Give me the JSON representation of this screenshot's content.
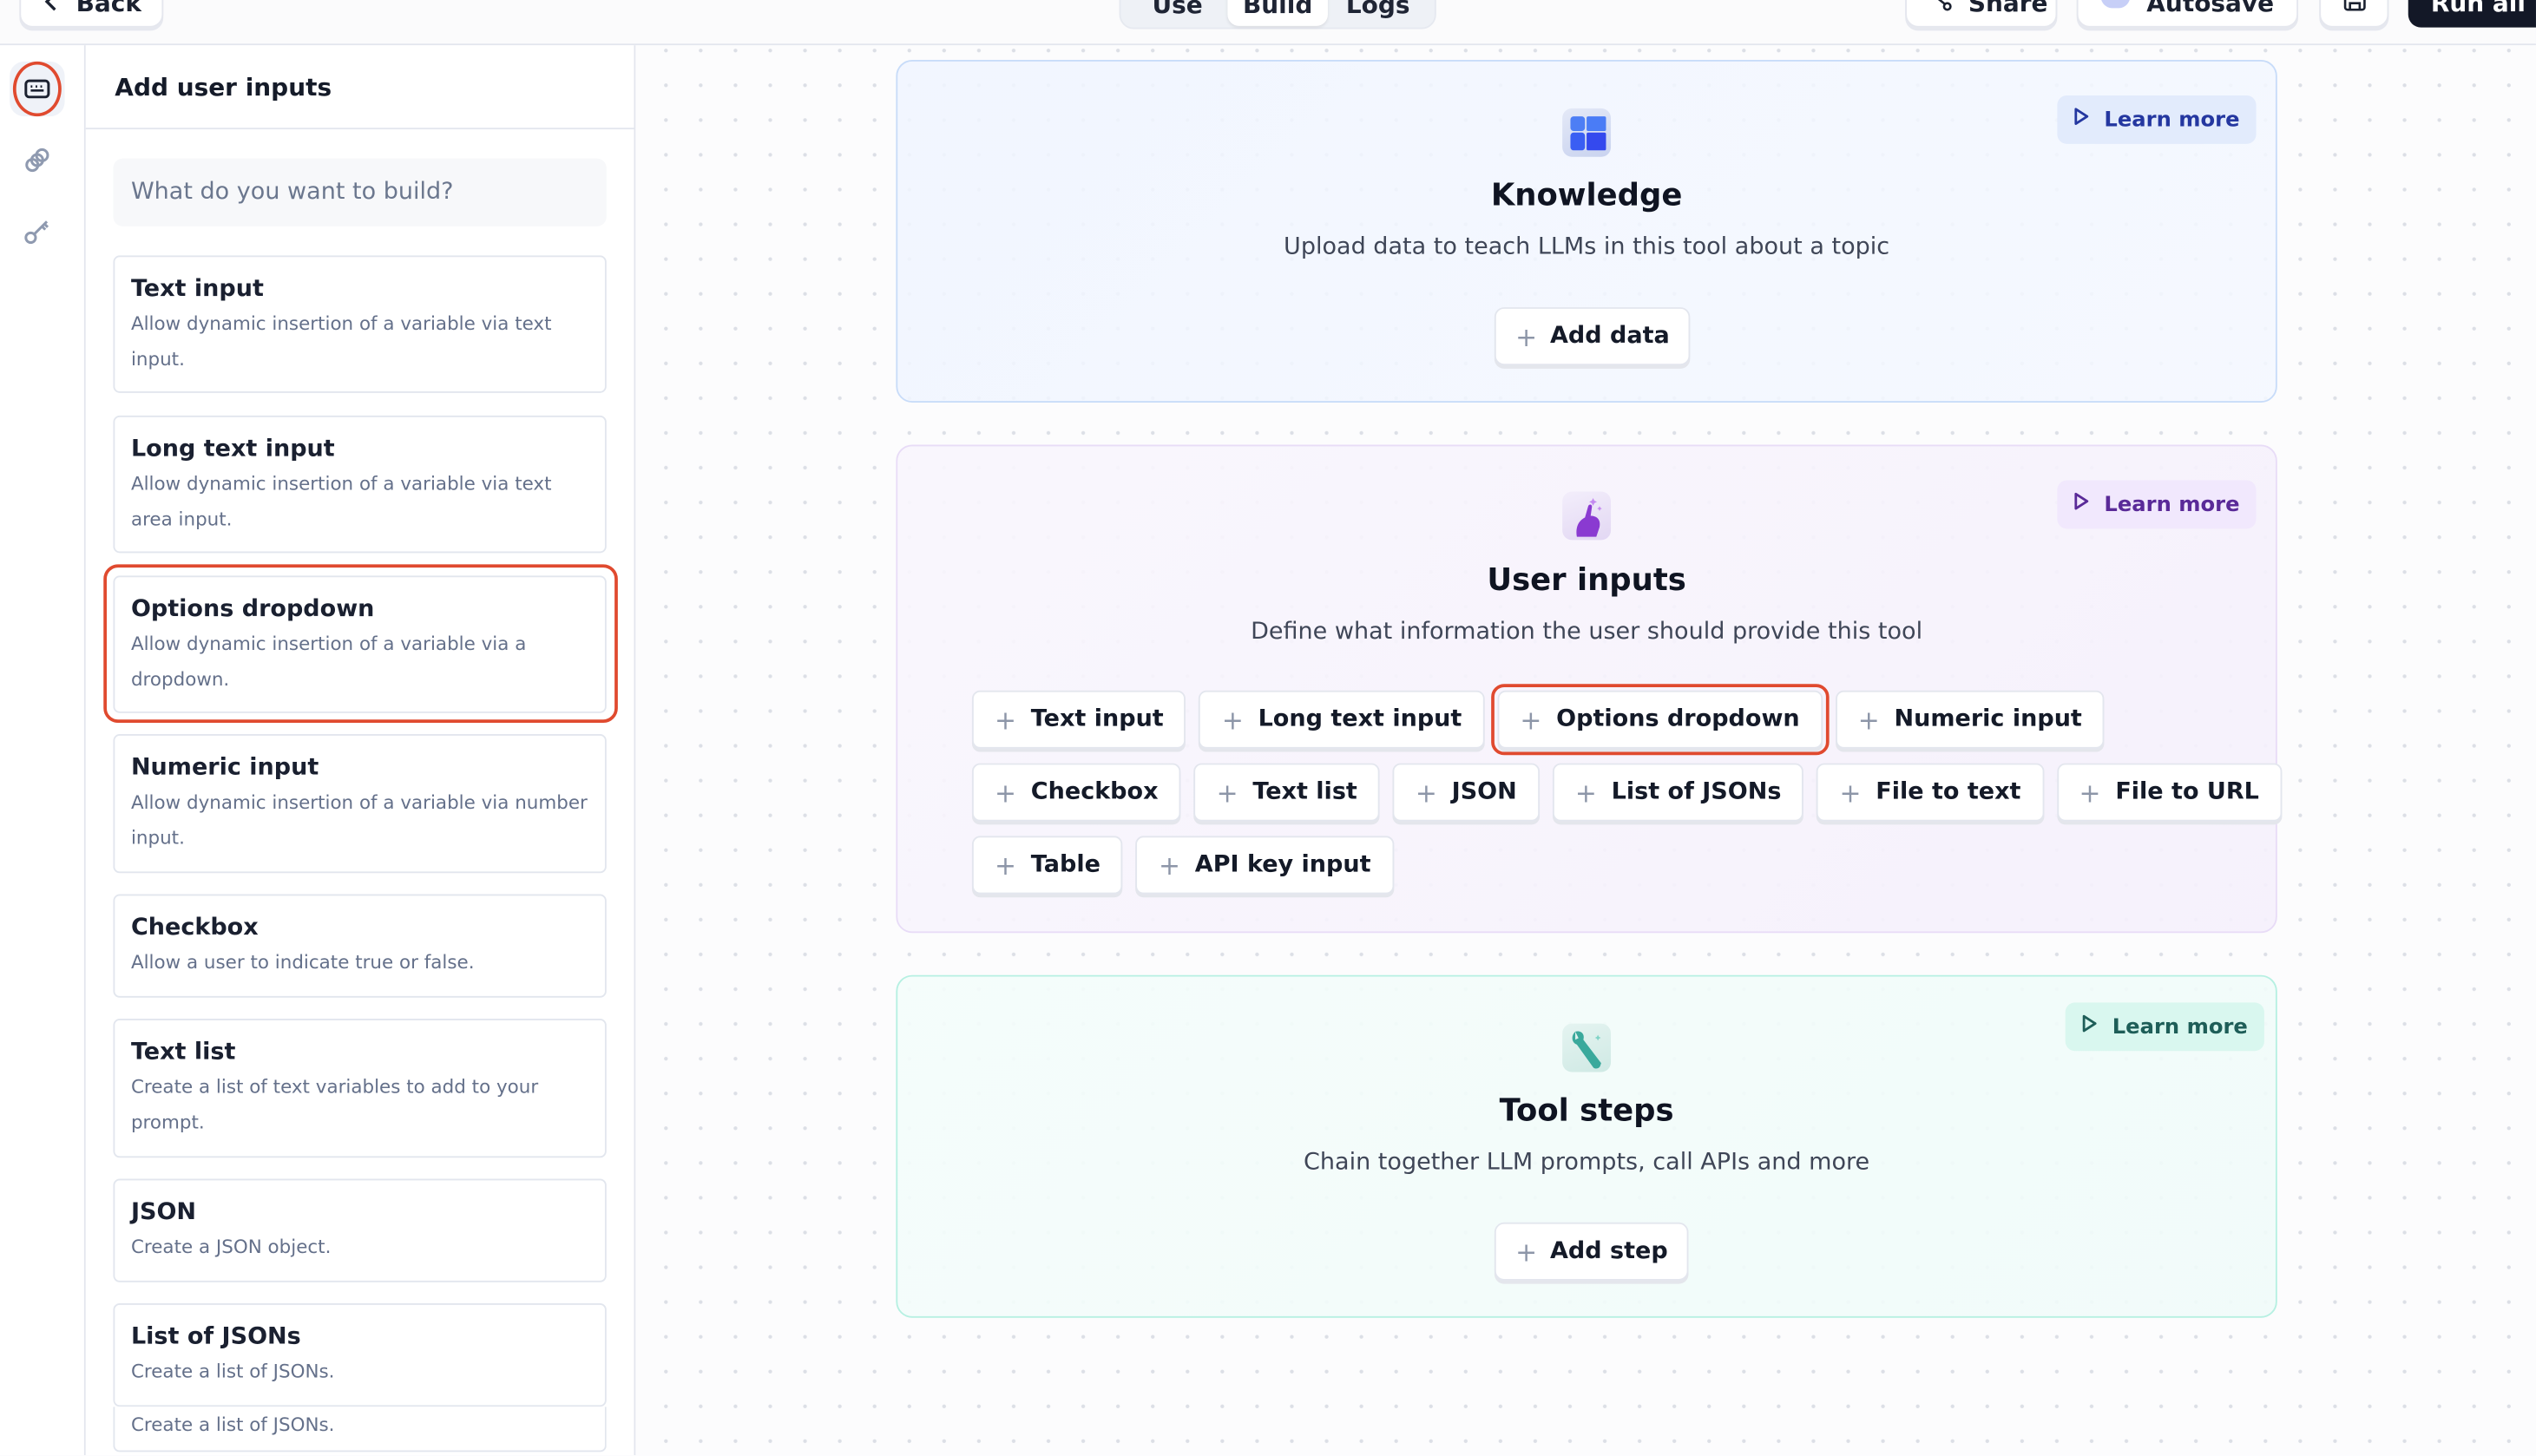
{
  "topbar": {
    "back_label": "Back",
    "tabs": [
      {
        "label": "Use",
        "active": false
      },
      {
        "label": "Build",
        "active": true
      },
      {
        "label": "Logs",
        "active": false
      }
    ],
    "share_label": "Share",
    "autosave_label": "Autosave",
    "run_all_label": "Run all"
  },
  "rail": {
    "items": [
      {
        "icon": "keyboard-icon",
        "active": true
      },
      {
        "icon": "link-icon",
        "active": false
      },
      {
        "icon": "key-icon",
        "active": false
      }
    ]
  },
  "panel": {
    "title": "Add user inputs",
    "search_placeholder": "What do you want to build?",
    "items": [
      {
        "title": "Text input",
        "desc": "Allow dynamic insertion of a variable via text input."
      },
      {
        "title": "Long text input",
        "desc": "Allow dynamic insertion of a variable via text area input."
      },
      {
        "title": "Options dropdown",
        "desc": "Allow dynamic insertion of a variable via a dropdown.",
        "highlighted": true
      },
      {
        "title": "Numeric input",
        "desc": "Allow dynamic insertion of a variable via number input."
      },
      {
        "title": "Checkbox",
        "desc": "Allow a user to indicate true or false."
      },
      {
        "title": "Text list",
        "desc": "Create a list of text variables to add to your prompt."
      },
      {
        "title": "JSON",
        "desc": "Create a JSON object."
      },
      {
        "title": "List of JSONs",
        "desc": "Create a list of JSONs."
      },
      {
        "title": "",
        "desc": "Create a list of JSONs."
      }
    ]
  },
  "sections": {
    "knowledge": {
      "title": "Knowledge",
      "subtitle": "Upload data to teach LLMs in this tool about a topic",
      "learn_more": "Learn more",
      "action": "Add data",
      "accent": "#2437a0"
    },
    "user_inputs": {
      "title": "User inputs",
      "subtitle": "Define what information the user should provide this tool",
      "learn_more": "Learn more",
      "accent": "#5a2a98",
      "chips": [
        [
          "Text input",
          "Long text input",
          "Options dropdown",
          "Numeric input"
        ],
        [
          "Checkbox",
          "Text list",
          "JSON",
          "List of JSONs",
          "File to text",
          "File to URL"
        ],
        [
          "Table",
          "API key input"
        ]
      ],
      "highlighted_chip": "Options dropdown"
    },
    "tool_steps": {
      "title": "Tool steps",
      "subtitle": "Chain together LLM prompts, call APIs and more",
      "learn_more": "Learn more",
      "action": "Add step",
      "accent": "#1e5e58"
    }
  },
  "colors": {
    "highlight_ring": "#e04a2f",
    "run_button_bg": "#131827"
  }
}
